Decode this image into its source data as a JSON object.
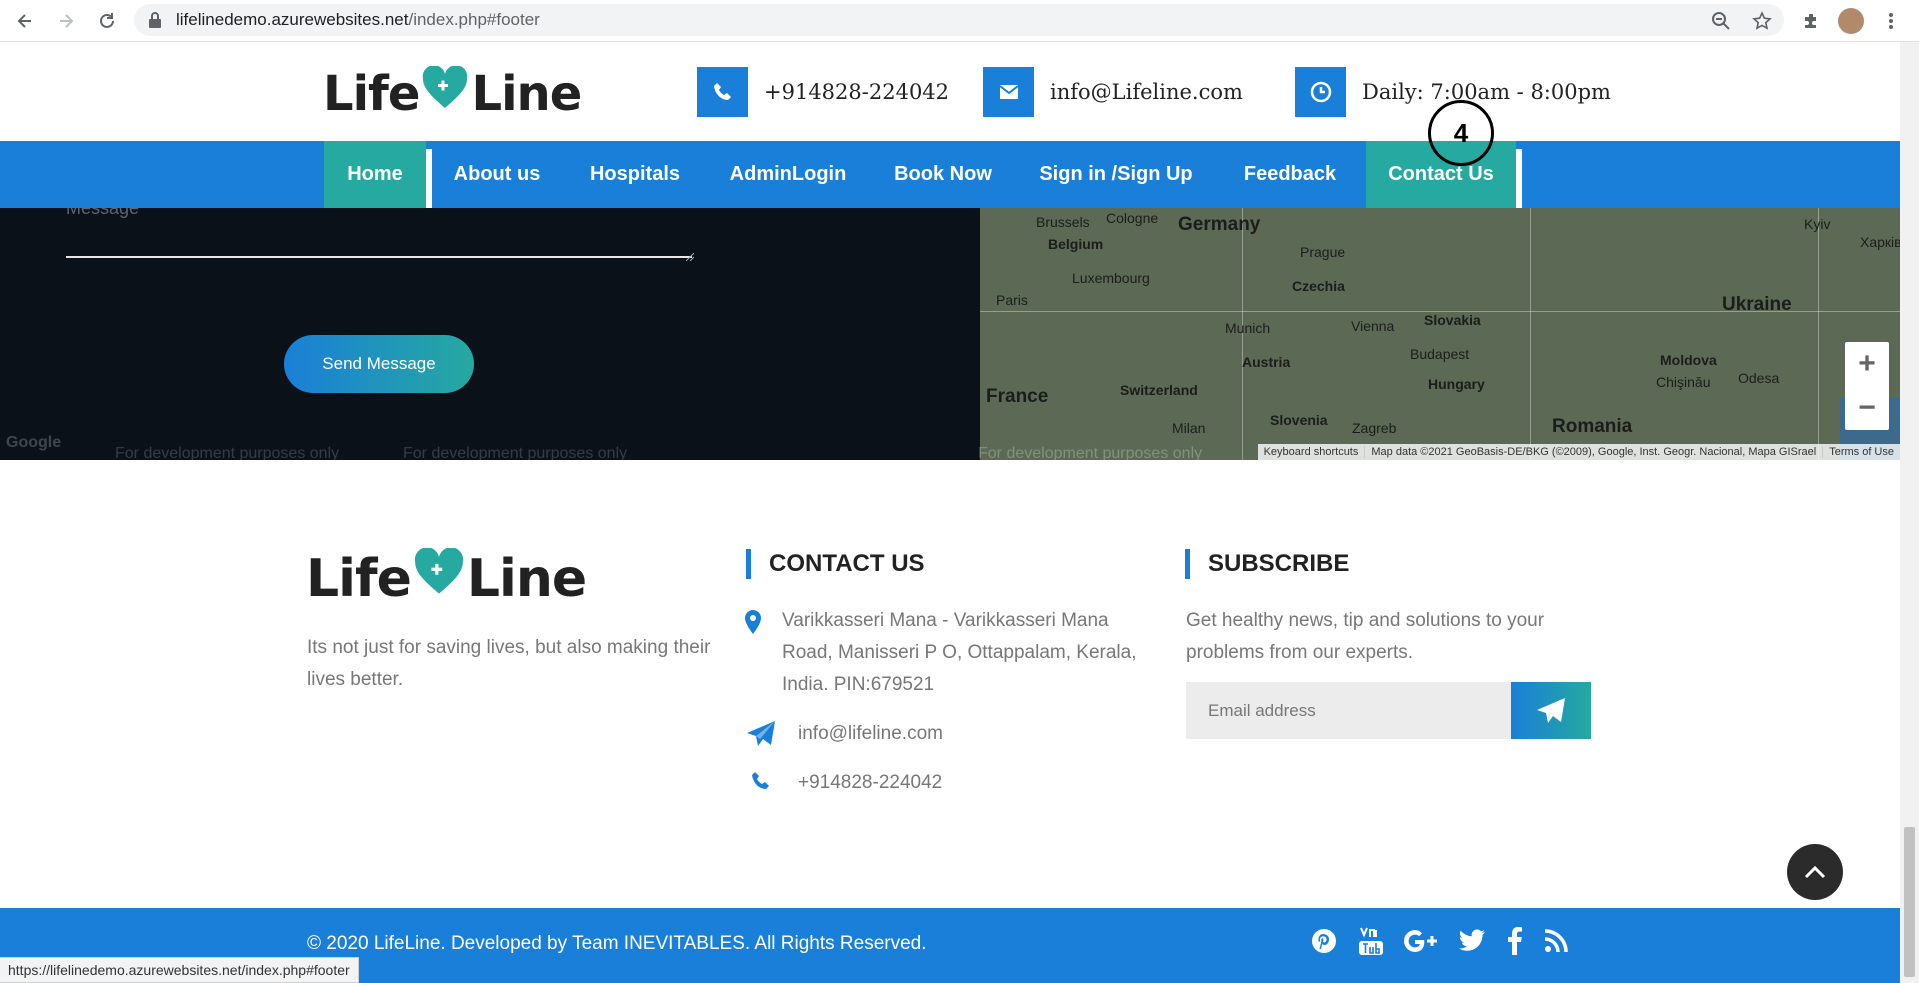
{
  "browser": {
    "url_host": "lifelinedemo.azurewebsites.net",
    "url_path": "/index.php#footer",
    "status_url": "https://lifelinedemo.azurewebsites.net/index.php#footer"
  },
  "header": {
    "logo_left": "Life",
    "logo_right": "Line",
    "phone": "+914828-224042",
    "email": "info@Lifeline.com",
    "hours": "Daily: 7:00am - 8:00pm"
  },
  "nav": {
    "items": [
      {
        "label": "Home",
        "active": true
      },
      {
        "label": "About us"
      },
      {
        "label": "Hospitals"
      },
      {
        "label": "AdminLogin"
      },
      {
        "label": "Book Now"
      },
      {
        "label": "Sign in /Sign Up"
      },
      {
        "label": "Feedback"
      },
      {
        "label": "Contact Us",
        "active": true
      }
    ]
  },
  "form": {
    "message_label": "Message",
    "send_button": "Send Message"
  },
  "map": {
    "labels": {
      "germany": "Germany",
      "brussels": "Brussels",
      "cologne": "Cologne",
      "belgium": "Belgium",
      "luxembourg": "Luxembourg",
      "prague": "Prague",
      "czechia": "Czechia",
      "paris": "Paris",
      "munich": "Munich",
      "vienna": "Vienna",
      "slovakia": "Slovakia",
      "austria": "Austria",
      "budapest": "Budapest",
      "hungary": "Hungary",
      "france": "France",
      "switzerland": "Switzerland",
      "milan": "Milan",
      "slovenia": "Slovenia",
      "zagreb": "Zagreb",
      "romania": "Romania",
      "ukraine": "Ukraine",
      "moldova": "Moldova",
      "chisinau": "Chişinău",
      "odesa": "Odesa",
      "kyiv": "Kyiv",
      "kharkiv": "Харків"
    },
    "dev_text": "For development purposes only",
    "footer_shortcuts": "Keyboard shortcuts",
    "footer_data": "Map data ©2021 GeoBasis-DE/BKG (©2009), Google, Inst. Geogr. Nacional, Mapa GISrael",
    "footer_terms": "Terms of Use",
    "google": "Google"
  },
  "footer": {
    "tagline": "Its not just for saving lives, but also making their lives better.",
    "contact_title": "CONTACT US",
    "address": "Varikkasseri Mana - Varikkasseri Mana Road, Manisseri P O, Ottappalam, Kerala, India. PIN:679521",
    "email": "info@lifeline.com",
    "phone": "+914828-224042",
    "subscribe_title": "SUBSCRIBE",
    "subscribe_text": "Get healthy news, tip and solutions to your problems from our experts.",
    "email_placeholder": "Email address",
    "copyright": "© 2020 LifeLine. Developed by Team INEVITABLES. All Rights Reserved."
  },
  "annotation": {
    "marker": "4"
  },
  "colors": {
    "primary": "#1a7fd8",
    "accent": "#26a9a0",
    "dark": "#0b1119"
  }
}
